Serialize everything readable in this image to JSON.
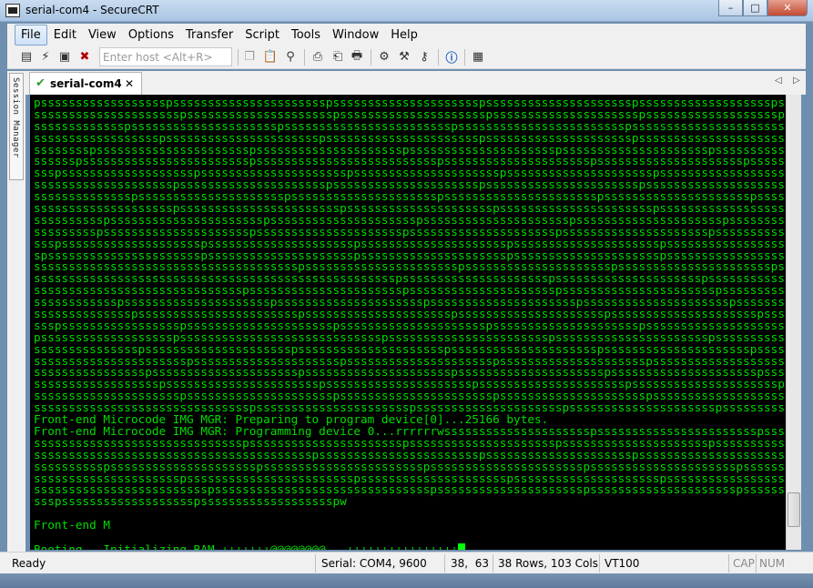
{
  "window": {
    "title": "serial-com4 - SecureCRT",
    "minimize_glyph": "–",
    "maximize_glyph": "□",
    "close_glyph": "✕"
  },
  "menu": [
    {
      "label": "File",
      "active": true
    },
    {
      "label": "Edit"
    },
    {
      "label": "View"
    },
    {
      "label": "Options"
    },
    {
      "label": "Transfer"
    },
    {
      "label": "Script"
    },
    {
      "label": "Tools"
    },
    {
      "label": "Window"
    },
    {
      "label": "Help"
    }
  ],
  "toolbar": {
    "host_placeholder": "Enter host <Alt+R>",
    "icons": [
      "connect-icon",
      "quick-connect-icon",
      "connect-in-tab-icon",
      "disconnect-icon",
      "copy-icon",
      "paste-icon",
      "find-icon",
      "print-icon",
      "print-screen-icon",
      "print-setup-icon",
      "session-options-icon",
      "global-options-icon",
      "keymap-icon",
      "help-icon",
      "sftp-icon"
    ]
  },
  "session_manager": {
    "label": "Session Manager"
  },
  "tabs": [
    {
      "label": "serial-com4",
      "status": "connected",
      "close_glyph": "✕"
    }
  ],
  "tab_nav": {
    "prev": "◁",
    "next": "▷"
  },
  "terminal": {
    "lines": [
      "psssssssssssssssssspsssssssssssssssssssssspssssssssssssssssssssspssssssssssssssssssssspssssssssssssssssssspss",
      "ssssssssssssssssssssspssssssssssssssssssssspssssssssssssssssssssspssssssssssssssssssssspssssssssssssssssssspss",
      "ssssssssssssspssssssssssssssssssssspsssssssssssssssssssssssspsssssssssssssssssssssssspssssssssssssssssssssssss",
      "sssssssssssssssssspsssssssssssssssssssssspsssssssssssssssssssssspssssssssssssssssssssspsssssssssssssssssssssss",
      "sssssssspsssssssssssssssssssssspssssssssssssssssssssspssssssssssssssssssssspssssssssssssssssssssspssssssssssss",
      "sssssspsssssssssssssssssssssssspsssssssssssssssssssssssssspssssssssssssssssssssspssssssssssssssssssssspsssssss",
      "ssspssssssssssssssssssspssssssssssssssssssssspssssssssssssssssssssspssssssssssssssssssssspssssssssssssssssssssp",
      "sssssssssssssssssssspssssssssssssssssssssspssssssssssssssssssssspsssssssssssssssssssssspsssssssssssssssssssssss",
      "sssssssssssssspssssssssssssssssssssspssssssssssssssssssssspsssssssssssssssssssssspssssssssssssssssssssspssssss",
      "sssssssssssssssssssspssssssssssssssssssssssspssssssssssssssssssssspsssssssssssssssssssssspssssssssssssssssssspss",
      "sssssssssspsssssssssssssssssssssspssssssssssssssssssssspssssssssssssssssssssspssssssssssssssssssssspsssssssssss",
      "ssssssssspssssssssssssssssssssspssssssssssssssssssssspssssssssssssssssssssspssssssssssssssssssssspsssssssssssss",
      "ssspsssssssssssssssssssspssssssssssssssssssssspssssssssssssssssssssspssssssssssssssssssssspsssssssssssssssssssss",
      "spsssssssssssssssssssssspssssssssssssssssssssspssssssssssssssssssssspssssssssssssssssssssspsssssssssssssssssssps",
      "sssssssssssssssssssssssssssssssssssssspsssssssssssssssssssssspssssssssssssssssssssspsssssssssssssssssssssspssss",
      "sssssssssssssssssssssssssssssssssssssssssssssssssssspssssssssssssssssssssspssssssssssssssssssssspssssssssssssss",
      "sssssssssssssssssssssssssssssspsssssssssssssssssssssspssssssssssssssssssssspsssssssssssssssssssssspssssssssssssss",
      "sssssssssssspssssssssssssssssssssspssssssssssssssssssssspssssssssssssssssssssspssssssssssssssssssssspsssssssssss",
      "sssssssssssssspssssssssssssssssssssssspssssssssssssssssssssspssssssssssssssssssssspssssssssssssssssssssspssssss",
      "ssspssssssssssssssssspssssssssssssssssssssspssssssssssssssssssssspssssssssssssssssssssspssssssssssssssssssssssss",
      "pssssssssssssssssssspssssssssssssssssssssssssssssspssssssssssssssssssssssspsssssssssssssssssssssspssssssssssssps",
      "ssssssssssssssspssssssssssssssssssssspssssssssssssssssssssspssssssssssssssssssssspssssssssssssssssssssspsssssss",
      "sssssssssssssssssssssspssssssssssssssssssssspssssssssssssssssssssspssssssssssssssssssssspsssssssssssssssssssssss",
      "sssssssssssssssspssssssssssssssssssssspssssssssssssssssssssspssssssssssssssssssssspssssssssssssssssssssspsssss",
      "sssssssssssssssssspsssssssssssssssssssssspssssssssssssssssssssspssssssssssssssssssssspssssssssssssssssssssspsss",
      "ssssssssssssssssssssspssssssssssssssssssssspsssssssssssssssssssssspssssssssssssssssssssspssssssssssssssssssssss",
      "ssssssssssssssssssssssssssssssspsssssssssssssssssssssspssssssssssssssssssssspssssssssssssssssssssspsssssssssssss",
      "Front-end Microcode IMG MGR: Preparing to program device[0]...25166 bytes.",
      "Front-end Microcode IMG MGR: Programming device 0...rrrrrrwssssssssssssssssssssspssssssssssssssssssssssspssss",
      "sssssssssssssssssssssssssssssspsssssssssssssssssssssspssssssssssssssssssssspssssssssssssssssssssspssssssssssss",
      "sssssssssssssssssssssssssssssssssssssssspssssssssssssssssssssssspssssssssssssssssssssspssssssssssssssssssssspss",
      "sssssssssspssssssssssssssssssssspssssssssssssssssssssssspsssssssssssssssssssssspssssssssssssssssssssspsssssssss",
      "ssssssssssssssssssssspsssssssssssssssssssssssspssssssssssssssssssssspssssssssssssssssssssspssssssssssssssssssss",
      "ssssssssssssssssssssssssspssssssssssssssssssssssssssssssspssssssssssssssssssssspssssssssssssssssssssspsssssssss",
      "ssspssssssssssssssssssspssssssssssssssssssspw",
      "",
      "Front-end M",
      "",
      "Booting...Initializing RAM +++++++@@@@@@@@...++++++++++++++++"
    ]
  },
  "status": {
    "ready": "Ready",
    "connection": "Serial: COM4, 9600",
    "cursor_pos": "38,  63",
    "dimensions": "38 Rows, 103 Cols",
    "emulation": "VT100",
    "caps": "CAP",
    "num": "NUM"
  },
  "colors": {
    "terminal_bg": "#000000",
    "terminal_fg": "#00dd00"
  }
}
